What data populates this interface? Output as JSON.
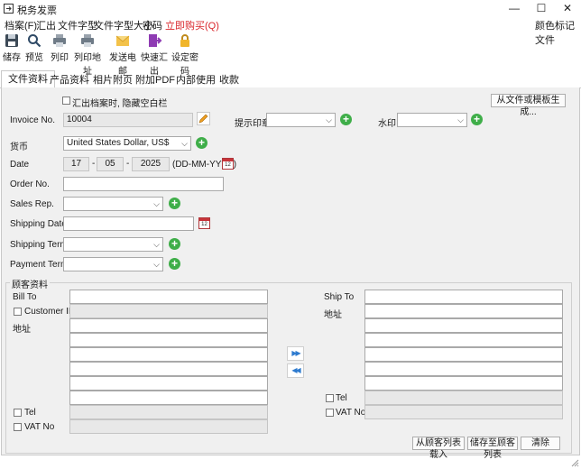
{
  "window": {
    "title": "税务发票",
    "minimize": "—",
    "maximize": "☐",
    "close": "✕"
  },
  "menu": {
    "file": "档案(F)",
    "export": "汇出",
    "font": "文件字型",
    "font_size": "文件字型大小",
    "password": "密码",
    "buy": "立即购买(Q)",
    "color_mark": "颜色标记文件"
  },
  "toolbar": {
    "save": "储存",
    "preview": "预览",
    "print": "列印",
    "print_address": "列印地址",
    "send_email": "发送电邮",
    "quick_export": "快速汇出",
    "set_password": "设定密码"
  },
  "tabs": [
    "文件资料",
    "产品资料",
    "相片附页",
    "附加PDF",
    "内部使用",
    "收款"
  ],
  "form": {
    "hide_blank_label": "汇出档案时, 隐藏空白栏",
    "generate_btn": "从文件或模板生成...",
    "invoice_no_label": "Invoice No.",
    "invoice_no_value": "10004",
    "reminder_stamp_label": "提示印章",
    "watermark_label": "水印",
    "currency_label": "货币",
    "currency_value": "United States Dollar, US$",
    "date_label": "Date",
    "date_day": "17",
    "date_month": "05",
    "date_year": "2025",
    "date_sep": "-",
    "date_format": "(DD-MM-YYYY)",
    "order_no_label": "Order No.",
    "sales_rep_label": "Sales Rep.",
    "shipping_date_label": "Shipping Date",
    "shipping_term_label": "Shipping Term",
    "payment_term_label": "Payment Term",
    "cal_num": "12"
  },
  "customer": {
    "group_label": "顾客资料",
    "bill_to": "Bill To",
    "customer_id": "Customer ID",
    "address": "地址",
    "tel": "Tel",
    "vat_no": "VAT No",
    "ship_to": "Ship To",
    "ship_address": "地址",
    "ship_tel": "Tel",
    "ship_vat_no": "VAT No",
    "copy_right": "▶▶",
    "copy_left": "◀◀",
    "load_btn": "从顾客列表载入",
    "save_btn": "储存至顾客列表",
    "clear_btn": "清除"
  },
  "colors": {
    "accent": "#2e7bcf",
    "buy": "#d9262b",
    "plus": "#3fae49"
  }
}
